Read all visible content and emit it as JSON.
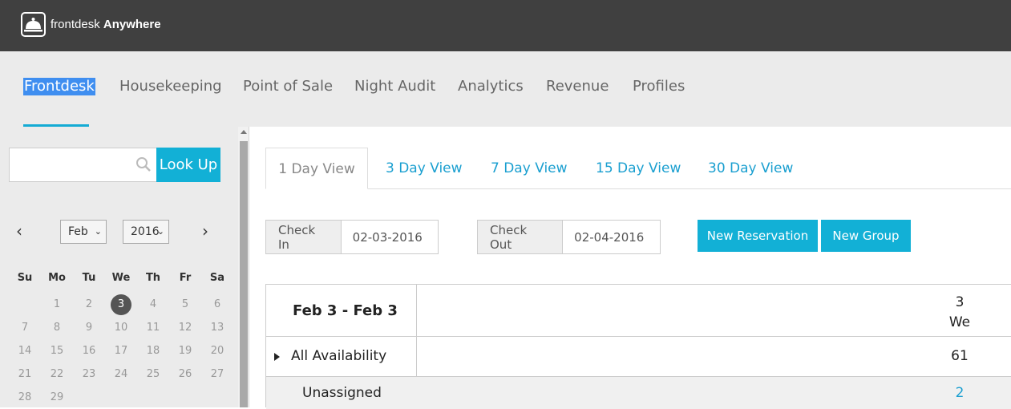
{
  "brand": {
    "name_regular": "frontdesk",
    "name_bold": "Anywhere",
    "logo_icon": "service-bell-icon"
  },
  "nav": {
    "items": [
      {
        "label": "Frontdesk",
        "active": true
      },
      {
        "label": "Housekeeping"
      },
      {
        "label": "Point of Sale"
      },
      {
        "label": "Night Audit"
      },
      {
        "label": "Analytics"
      },
      {
        "label": "Revenue"
      },
      {
        "label": "Profiles"
      }
    ]
  },
  "search": {
    "value": "",
    "placeholder": "",
    "button_label": "Look Up",
    "icon": "search-icon"
  },
  "calendar": {
    "prev": "‹",
    "next": "›",
    "month": "Feb",
    "year": "2016",
    "weekdays": [
      "Su",
      "Mo",
      "Tu",
      "We",
      "Th",
      "Fr",
      "Sa"
    ],
    "weeks": [
      [
        "",
        "1",
        "2",
        "3",
        "4",
        "5",
        "6"
      ],
      [
        "7",
        "8",
        "9",
        "10",
        "11",
        "12",
        "13"
      ],
      [
        "14",
        "15",
        "16",
        "17",
        "18",
        "19",
        "20"
      ],
      [
        "21",
        "22",
        "23",
        "24",
        "25",
        "26",
        "27"
      ],
      [
        "28",
        "29",
        "",
        "",
        "",
        "",
        ""
      ]
    ],
    "selected_day": "3"
  },
  "tabs": [
    "1 Day View",
    "3 Day View",
    "7 Day View",
    "15 Day View",
    "30 Day View"
  ],
  "check_in": {
    "label": "Check In",
    "value": "02-03-2016"
  },
  "check_out": {
    "label": "Check Out",
    "value": "02-04-2016"
  },
  "buttons": {
    "new_reservation": "New Reservation",
    "new_group": "New Group"
  },
  "grid": {
    "range_title": "Feb 3 - Feb 3",
    "col_day_num": "3",
    "col_day_name": "We",
    "rows": [
      {
        "label": "All Availability",
        "value": "61"
      },
      {
        "label": "Unassigned",
        "value": "2"
      }
    ]
  },
  "colors": {
    "accent": "#12b0d6",
    "topbar": "#404040",
    "nav_bg": "#ebebeb",
    "selection": "#3f8ef0"
  }
}
